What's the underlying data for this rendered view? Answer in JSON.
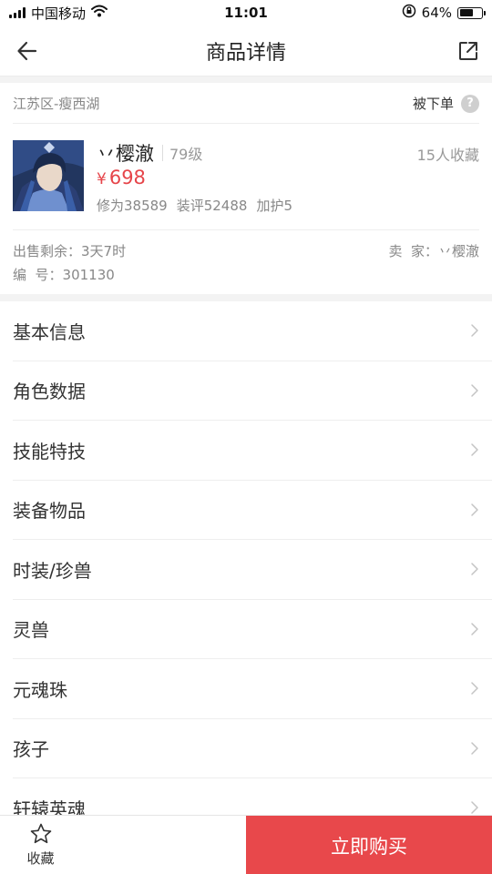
{
  "status_bar": {
    "carrier": "中国移动",
    "time": "11:01",
    "battery_percent": "64%",
    "battery_level": 0.64
  },
  "nav": {
    "title": "商品详情",
    "icons": {
      "back": "arrow-left-icon",
      "share": "share-icon"
    }
  },
  "region": {
    "text": "江苏区-瘦西湖",
    "ordered_label": "被下单",
    "help_icon": "?"
  },
  "role": {
    "name": "丷樱澈",
    "level": "79级",
    "favorites": "15人收藏",
    "currency": "¥",
    "price": "698",
    "stats": [
      "修为38589",
      "装评52488",
      "加护5"
    ]
  },
  "meta": {
    "remaining_label": "出售剩余：",
    "remaining_value": "3天7时",
    "seller_label": "卖  家：",
    "seller_value": "丷樱澈",
    "id_label": "编  号：",
    "id_value": "301130"
  },
  "sections": [
    {
      "label": "基本信息"
    },
    {
      "label": "角色数据"
    },
    {
      "label": "技能特技"
    },
    {
      "label": "装备物品"
    },
    {
      "label": "时装/珍兽"
    },
    {
      "label": "灵兽"
    },
    {
      "label": "元魂珠"
    },
    {
      "label": "孩子"
    },
    {
      "label": "轩辕英魂"
    }
  ],
  "bottom": {
    "favorite_label": "收藏",
    "buy_label": "立即购买"
  },
  "colors": {
    "accent": "#e8484b",
    "price": "#e6454a",
    "muted_text": "#888888",
    "separator": "#f3f3f3"
  }
}
